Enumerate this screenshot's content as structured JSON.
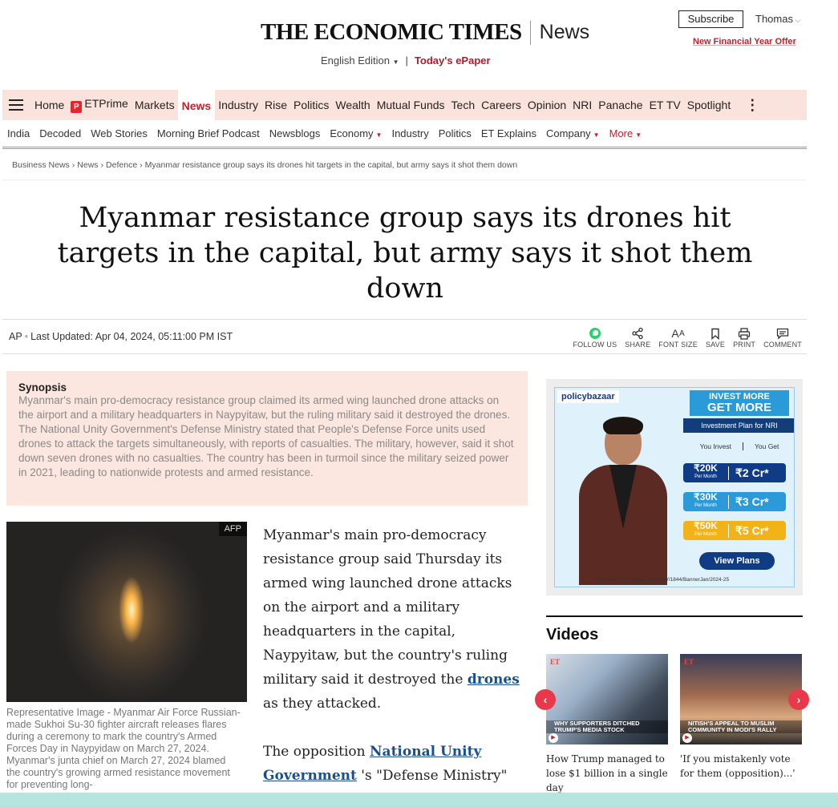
{
  "header": {
    "logo_text": "THE ECONOMIC TIMES",
    "section": "News",
    "edition": "English Edition",
    "separator": "|",
    "epaper": "Today's ePaper",
    "subscribe": "Subscribe",
    "user": "Thomas",
    "offer": "New Financial Year Offer"
  },
  "main_nav": {
    "items": [
      "Home",
      "ETPrime",
      "Markets",
      "News",
      "Industry",
      "Rise",
      "Politics",
      "Wealth",
      "Mutual Funds",
      "Tech",
      "Careers",
      "Opinion",
      "NRI",
      "Panache",
      "ET TV",
      "Spotlight"
    ],
    "active": "News",
    "etprime_badge": "P"
  },
  "sub_nav": {
    "items": [
      "India",
      "Decoded",
      "Web Stories",
      "Morning Brief Podcast",
      "Newsblogs",
      "Economy",
      "Industry",
      "Politics",
      "ET Explains",
      "Company",
      "More"
    ]
  },
  "breadcrumb": [
    "Business News",
    "News",
    "Defence",
    "Myanmar resistance group says its drones hit targets in the capital, but army says it shot them down"
  ],
  "article": {
    "headline": "Myanmar resistance group says its drones hit targets in the capital, but army says it shot them down",
    "source": "AP",
    "updated": "Last Updated: Apr 04, 2024, 05:11:00 PM IST",
    "tools": [
      "FOLLOW US",
      "SHARE",
      "FONT SIZE",
      "SAVE",
      "PRINT",
      "COMMENT"
    ],
    "synopsis_title": "Synopsis",
    "synopsis": "Myanmar's main pro-democracy resistance group claimed its armed wing launched drone attacks on the airport and a military headquarters in Naypyitaw, but the ruling military said it destroyed the drones. The National Unity Government's Defense Ministry stated that People's Defense Force units used drones to attack the targets simultaneously, with reports of casualties. The military, however, said it shot down seven drones with no casualties. The country has been in turmoil since the military seized power in 2021, leading to nationwide protests and armed resistance.",
    "image_credit": "AFP",
    "image_caption": "Representative Image - Myanmar Air Force Russian-made Sukhoi Su-30 fighter aircraft releases flares during a ceremony to mark the country's Armed Forces Day in Naypyidaw on March 27, 2024. Myanmar's junta chief on March 27, 2024 blamed the country's growing armed resistance movement for preventing long-",
    "p1_text": "Myanmar's main pro-democracy resistance group said Thursday its armed wing launched drone attacks on the airport and a military headquarters in the capital, Naypyitaw, but the country's ruling military said it destroyed the",
    "p1_link": "drones",
    "p1_end": "as they attacked.",
    "p2_start": "The opposition",
    "p2_link": "National Unity Government",
    "p2_text": "'s \"Defense Ministry\" said in a statement that special units of the"
  },
  "ad": {
    "brand": "policybazaar",
    "line1": "INVEST MORE",
    "line2": "GET MORE",
    "plan": "Investment Plan for NRI",
    "col1": "You Invest",
    "col2": "You Get",
    "rows": [
      {
        "invest": "₹20K",
        "per": "Per Month",
        "get": "₹2 Cr*",
        "color": "#103c86"
      },
      {
        "invest": "₹30K",
        "per": "Per Month",
        "get": "₹3 Cr*",
        "color": "#2a9bd8"
      },
      {
        "invest": "₹50K",
        "per": "Per Month",
        "get": "₹5 Cr*",
        "color": "#f2b318"
      }
    ],
    "cta": "View Plans",
    "fine": "*standard T&C Apply | UIN/ADV/1844/BannerJan/2024-25"
  },
  "videos": {
    "title": "Videos",
    "items": [
      {
        "overlay": "WHY SUPPORTERS DITCHED TRUMP'S MEDIA STOCK",
        "title": "How Trump managed to lose $1 billion in a single day"
      },
      {
        "overlay": "NITISH'S APPEAL TO MUSLIM COMMUNITY IN MODI'S RALLY",
        "title": "'If you mistakenly vote for them (opposition)...'"
      }
    ],
    "badge": "ET"
  },
  "colors": {
    "brand_red": "#c3202f",
    "nav_bg": "#fbe3dd",
    "synopsis_bg": "#fce6e0",
    "link_blue": "#1a4f8b",
    "bottom_bar": "#b5e5de"
  }
}
